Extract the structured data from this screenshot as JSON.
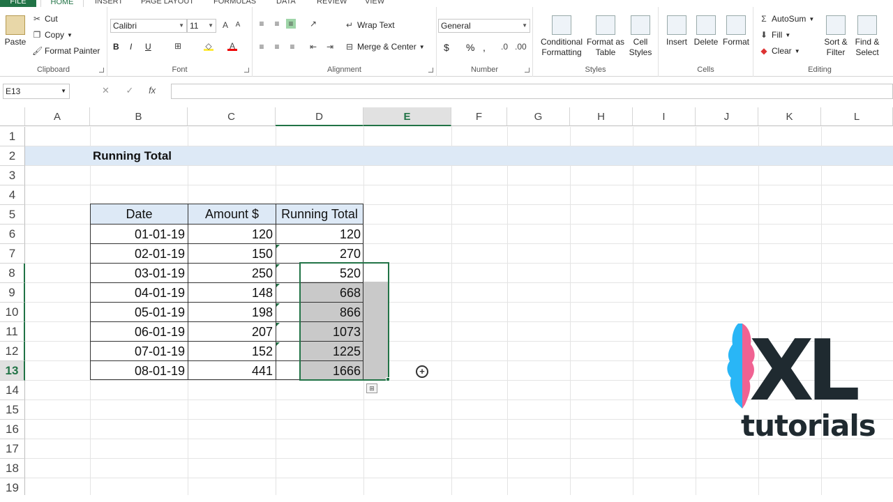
{
  "tabs": [
    "FILE",
    "HOME",
    "INSERT",
    "PAGE LAYOUT",
    "FORMULAS",
    "DATA",
    "REVIEW",
    "VIEW"
  ],
  "clipboard": {
    "paste": "Paste",
    "cut": "Cut",
    "copy": "Copy",
    "format_painter": "Format Painter",
    "label": "Clipboard"
  },
  "font": {
    "name": "Calibri",
    "size": "11",
    "bold": "B",
    "italic": "I",
    "underline": "U",
    "label": "Font"
  },
  "alignment": {
    "wrap": "Wrap Text",
    "merge": "Merge & Center",
    "label": "Alignment"
  },
  "number": {
    "format": "General",
    "currency": "$",
    "percent": "%",
    "comma": ",",
    "label": "Number"
  },
  "styles": {
    "conditional": "Conditional Formatting",
    "format_table": "Format as Table",
    "cell_styles": "Cell Styles",
    "label": "Styles"
  },
  "cells": {
    "insert": "Insert",
    "delete": "Delete",
    "format": "Format",
    "label": "Cells"
  },
  "editing": {
    "autosum": "AutoSum",
    "fill": "Fill",
    "clear": "Clear",
    "sort": "Sort & Filter",
    "find": "Find & Select",
    "label": "Editing"
  },
  "namebox": "E13",
  "fx": "fx",
  "columns": [
    "A",
    "B",
    "C",
    "D",
    "E",
    "F",
    "G",
    "H",
    "I",
    "J",
    "K",
    "L"
  ],
  "rows": [
    "1",
    "2",
    "3",
    "4",
    "5",
    "6",
    "7",
    "8",
    "9",
    "10",
    "11",
    "12",
    "13",
    "14",
    "15",
    "16",
    "17",
    "18",
    "19"
  ],
  "sheet": {
    "title": "Running Total",
    "headers": [
      "Date",
      "Amount $",
      "Running Total"
    ],
    "data": [
      [
        "01-01-19",
        "120",
        "120"
      ],
      [
        "02-01-19",
        "150",
        "270"
      ],
      [
        "03-01-19",
        "250",
        "520"
      ],
      [
        "04-01-19",
        "148",
        "668"
      ],
      [
        "05-01-19",
        "198",
        "866"
      ],
      [
        "06-01-19",
        "207",
        "1073"
      ],
      [
        "07-01-19",
        "152",
        "1225"
      ],
      [
        "08-01-19",
        "441",
        "1666"
      ]
    ]
  },
  "logo": {
    "mark": "XL",
    "text": "tutorials"
  },
  "colors": {
    "excel_green": "#217346",
    "header_fill": "#dde9f6",
    "selection_grey": "#c9c9c9"
  }
}
